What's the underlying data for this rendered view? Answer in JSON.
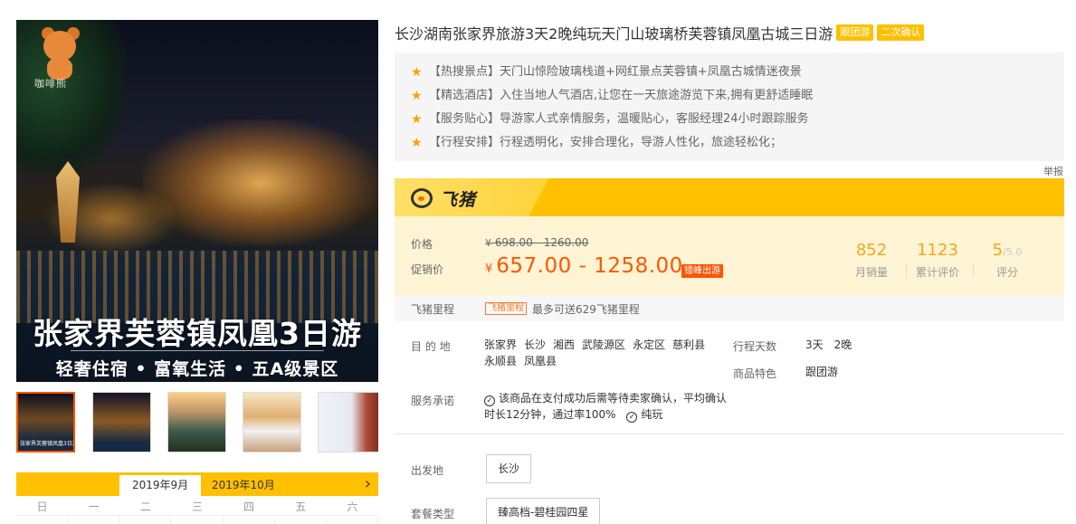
{
  "gallery": {
    "logo_text": "咖啡熊",
    "main_image_title": "张家界芙蓉镇凤凰3日游",
    "main_image_subtitle": "轻奢住宿 • 富氧生活 • 五A级景区",
    "thumbnails": [
      {
        "name": "phoenix-night",
        "caption": "张家界芙蓉镇凤凰3日游"
      },
      {
        "name": "phoenix-night-2",
        "caption": ""
      },
      {
        "name": "mountain-sunrise",
        "caption": ""
      },
      {
        "name": "hotel-room",
        "caption": ""
      },
      {
        "name": "promo-banner",
        "caption": ""
      }
    ]
  },
  "calendar": {
    "months": [
      "2019年9月",
      "2019年10月"
    ],
    "next_label": "›",
    "weekdays": [
      "日",
      "一",
      "二",
      "三",
      "四",
      "五",
      "六"
    ]
  },
  "product": {
    "title": "长沙湖南张家界旅游3天2晚纯玩天门山玻璃桥芙蓉镇凤凰古城三日游",
    "tags": [
      "跟团游",
      "二次确认"
    ],
    "highlights": [
      "【热搜景点】天门山惊险玻璃栈道+网红景点芙蓉镇+凤凰古城情迷夜景",
      "【精选酒店】入住当地人气酒店,让您在一天旅途游览下来,拥有更舒适睡眠",
      "【服务贴心】导游家人式亲情服务，温暖贴心，客服经理24小时跟踪服务",
      "【行程安排】行程透明化，安排合理化，导游人性化，旅途轻松化；"
    ],
    "report_label": "举报"
  },
  "brand": {
    "name": "飞猪"
  },
  "pricing": {
    "price_label": "价格",
    "promo_label": "促销价",
    "currency": "¥",
    "original_range": "698.00 - 1260.00",
    "promo_range": "657.00 - 1258.00",
    "offpeak_badge": "错峰出游",
    "stats": [
      {
        "value": "852",
        "suffix": "",
        "label": "月销量"
      },
      {
        "value": "1123",
        "suffix": "",
        "label": "累计评价"
      },
      {
        "value": "5",
        "suffix": "/5.0",
        "label": "评分"
      }
    ]
  },
  "mileage": {
    "label": "飞猪里程",
    "badge": "飞猪里程",
    "text": "最多可送629飞猪里程"
  },
  "details": {
    "destination_label": "目 的 地",
    "destinations": [
      "张家界",
      "长沙",
      "湘西",
      "武陵源区",
      "永定区",
      "慈利县",
      "永顺县",
      "凤凰县"
    ],
    "days_label": "行程天数",
    "days_value": "3天　2晚",
    "feature_label": "商品特色",
    "feature_value": "跟团游",
    "service_label": "服务承诺",
    "service_text": "该商品在支付成功后需等待卖家确认，平均确认时长12分钟，通过率100%",
    "service_text_2": "纯玩"
  },
  "options": {
    "departure_label": "出发地",
    "departure_value": "长沙",
    "package_label": "套餐类型",
    "package_value": "臻高档-碧桂园四星"
  }
}
